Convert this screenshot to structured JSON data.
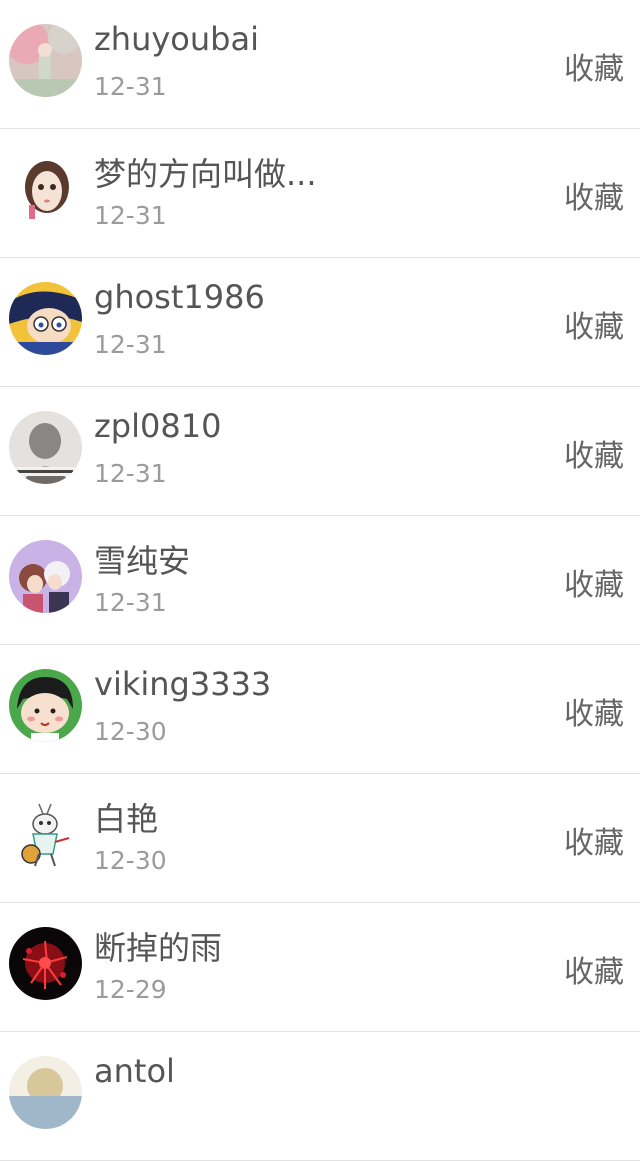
{
  "rows": [
    {
      "name": "zhuyoubai",
      "date": "12-31",
      "action": "收藏"
    },
    {
      "name": "梦的方向叫做...",
      "date": "12-31",
      "action": "收藏"
    },
    {
      "name": "ghost1986",
      "date": "12-31",
      "action": "收藏"
    },
    {
      "name": "zpl0810",
      "date": "12-31",
      "action": "收藏"
    },
    {
      "name": "雪纯安",
      "date": "12-31",
      "action": "收藏"
    },
    {
      "name": "viking3333",
      "date": "12-30",
      "action": "收藏"
    },
    {
      "name": "白艳",
      "date": "12-30",
      "action": "收藏"
    },
    {
      "name": "断掉的雨",
      "date": "12-29",
      "action": "收藏"
    },
    {
      "name": "antol",
      "date": "",
      "action": ""
    }
  ]
}
